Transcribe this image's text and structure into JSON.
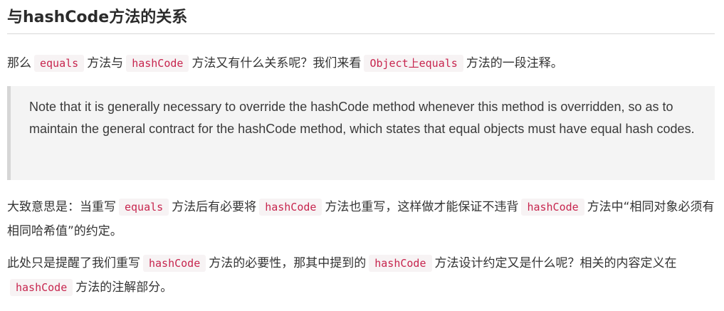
{
  "title": "与hashCode方法的关系",
  "para1": {
    "t1": "那么",
    "c1": "equals",
    "t2": "方法与",
    "c2": "hashCode",
    "t3": "方法又有什么关系呢？我们来看",
    "c3": "Object上equals",
    "t4": "方法的一段注释。"
  },
  "quote": "Note that it is generally necessary to override the hashCode method whenever this method is overridden, so as to maintain the general contract for the hashCode method, which states that equal objects must have equal hash codes.",
  "para2": {
    "t1": "大致意思是：当重写",
    "c1": "equals",
    "t2": "方法后有必要将",
    "c2": "hashCode",
    "t3": "方法也重写，这样做才能保证不违背",
    "c3": "hashCode",
    "t4": "方法中“相同对象必须有相同哈希值”的约定。"
  },
  "para3": {
    "t1": "此处只是提醒了我们重写",
    "c1": "hashCode",
    "t2": "方法的必要性，那其中提到的",
    "c2": "hashCode",
    "t3": "方法设计约定又是什么呢？相关的内容定义在",
    "c3": "hashCode",
    "t4": "方法的注解部分。"
  },
  "colors": {
    "code_text": "#c7254e",
    "code_bg": "#f7f3f4",
    "quote_bg": "#f4f4f4",
    "quote_border": "#d6d6d6"
  }
}
